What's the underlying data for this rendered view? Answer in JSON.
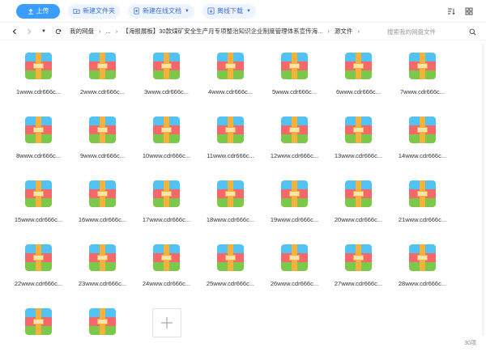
{
  "toolbar": {
    "upload_label": "上传",
    "new_folder_label": "新建文件夹",
    "new_online_doc_label": "新建在线文档",
    "offline_download_label": "离线下载"
  },
  "nav": {
    "breadcrumbs": [
      "我的网盘",
      "...",
      "【海报展板】30款煤矿安全生产月专项整治知识企业制度管理体系宣传海...",
      "源文件"
    ],
    "search_placeholder": "搜索我的网盘文件"
  },
  "files": [
    "1www.cdr666c...",
    "2www.cdr666c...",
    "3www.cdr666c...",
    "4www.cdr666c...",
    "5www.cdr666c...",
    "6www.cdr666c...",
    "7www.cdr666c...",
    "8www.cdr666c...",
    "9www.cdr666c...",
    "10www.cdr666c...",
    "11www.cdr666c...",
    "12www.cdr666c...",
    "13www.cdr666c...",
    "14www.cdr666c...",
    "15www.cdr666c...",
    "16www.cdr666c...",
    "17www.cdr666c...",
    "18www.cdr666c...",
    "19www.cdr666c...",
    "20www.cdr666c...",
    "21www.cdr666c...",
    "22www.cdr666c...",
    "23www.cdr666c...",
    "24www.cdr666c...",
    "25www.cdr666c...",
    "26www.cdr666c...",
    "27www.cdr666c...",
    "28www.cdr666c...",
    "",
    ""
  ],
  "footer": {
    "count": "30项"
  },
  "colors": {
    "accent": "#3a9dff",
    "zip_blue": "#52c2f2",
    "zip_red": "#f4676b",
    "zip_green": "#7cc84b",
    "zip_strap": "#f4b23d"
  },
  "icons": {
    "upload": "upload-icon",
    "folder": "folder-plus-icon",
    "doc": "doc-plus-icon",
    "download": "download-icon",
    "sort": "sort-icon",
    "grid": "grid-view-icon",
    "file": "zip-archive-icon",
    "search": "search-icon"
  }
}
